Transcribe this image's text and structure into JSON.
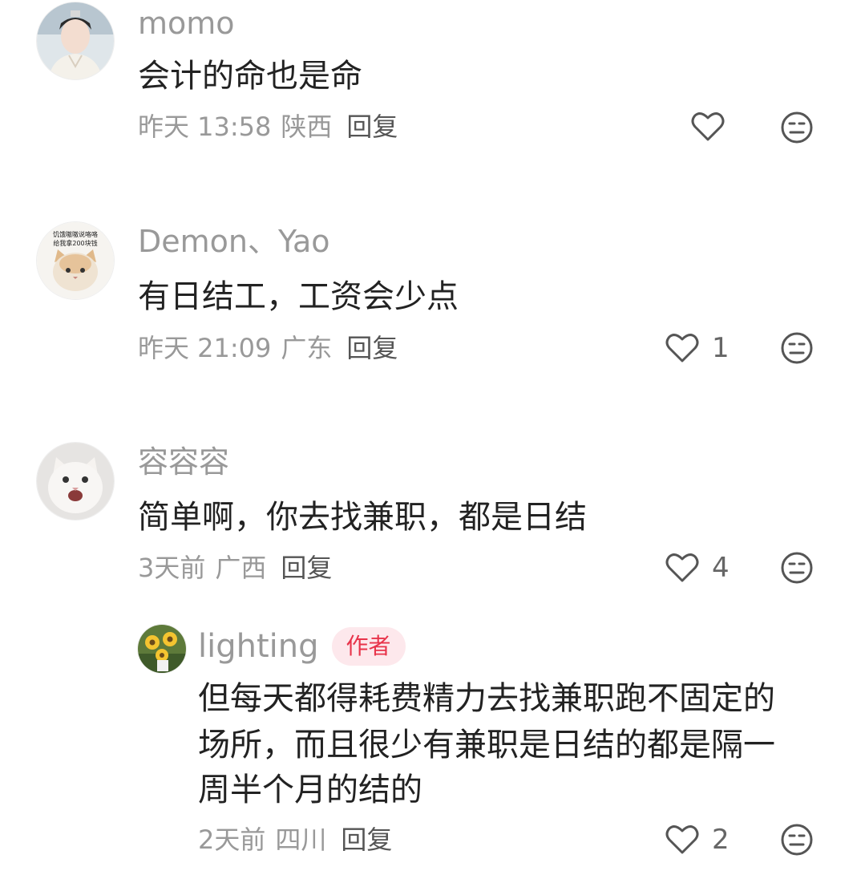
{
  "comments": [
    {
      "username": "momo",
      "text": "会计的命也是命",
      "time": "昨天 13:58",
      "location": "陕西",
      "reply_label": "回复",
      "likes": "",
      "avatar_icon": "person-avatar-icon"
    },
    {
      "username": "Demon、Yao",
      "text": "有日结工，工资会少点",
      "time": "昨天 21:09",
      "location": "广东",
      "reply_label": "回复",
      "likes": "1",
      "avatar_icon": "cat-avatar-icon",
      "avatar_caption_line1": "饥饿嗷嗷说咯咯",
      "avatar_caption_line2": "给我拿200块钱"
    },
    {
      "username": "容容容",
      "text": "简单啊，你去找兼职，都是日结",
      "time": "3天前",
      "location": "广西",
      "reply_label": "回复",
      "likes": "4",
      "avatar_icon": "white-cat-avatar-icon"
    }
  ],
  "reply": {
    "username": "lighting",
    "badge": "作者",
    "text_lines": [
      "但每天都得耗费精力去找兼职跑不固定的",
      "场所，而且很少有兼职是日结的都是隔一",
      "周半个月的结的"
    ],
    "time": "2天前",
    "location": "四川",
    "reply_label": "回复",
    "likes": "2",
    "avatar_icon": "sunflower-avatar-icon"
  },
  "colors": {
    "meta_gray": "#999999",
    "text_dark": "#222222",
    "badge_bg": "#fde8ec",
    "badge_text": "#e8334a"
  }
}
